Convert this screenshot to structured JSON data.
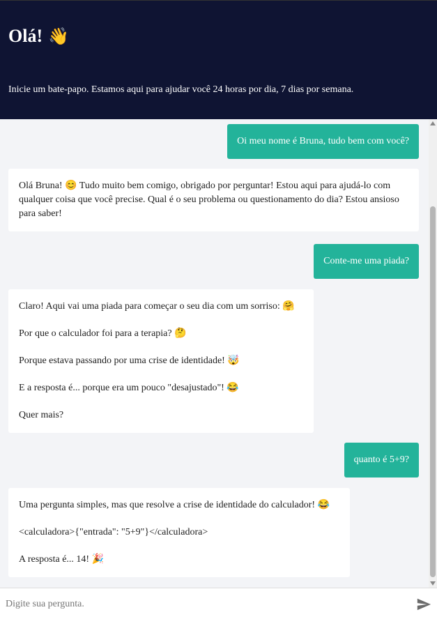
{
  "header": {
    "title": "Olá!",
    "wave_emoji": "👋",
    "subtitle": "Inicie um bate-papo. Estamos aqui para ajudar você 24 horas por dia, 7 dias por semana."
  },
  "messages": [
    {
      "role": "user",
      "text": "Oi meu nome é Bruna, tudo bem com você?"
    },
    {
      "role": "bot",
      "paragraphs": [
        "Olá Bruna! 😊 Tudo muito bem comigo, obrigado por perguntar! Estou aqui para ajudá-lo com qualquer coisa que você precise. Qual é o seu problema ou questionamento do dia? Estou ansioso para saber!"
      ]
    },
    {
      "role": "user",
      "text": "Conte-me uma piada?"
    },
    {
      "role": "bot",
      "paragraphs": [
        "Claro! Aqui vai uma piada para começar o seu dia com um sorriso: 🤗",
        "Por que o calculador foi para a terapia? 🤔",
        "Porque estava passando por uma crise de identidade! 🤯",
        "E a resposta é... porque era um pouco \"desajustado\"! 😂",
        "Quer mais?"
      ]
    },
    {
      "role": "user",
      "text": "quanto é 5+9?"
    },
    {
      "role": "bot",
      "paragraphs": [
        "Uma pergunta simples, mas que resolve a crise de identidade do calculador! 😂",
        "<calculadora>{\"entrada\": \"5+9\"}</calculadora>",
        "A resposta é... 14! 🎉"
      ]
    }
  ],
  "input": {
    "placeholder": "Digite sua pergunta."
  },
  "colors": {
    "header_bg": "#0f1433",
    "user_bubble": "#23b39a",
    "chat_bg": "#f3f4f7"
  },
  "icons": {
    "send": "send-icon"
  }
}
